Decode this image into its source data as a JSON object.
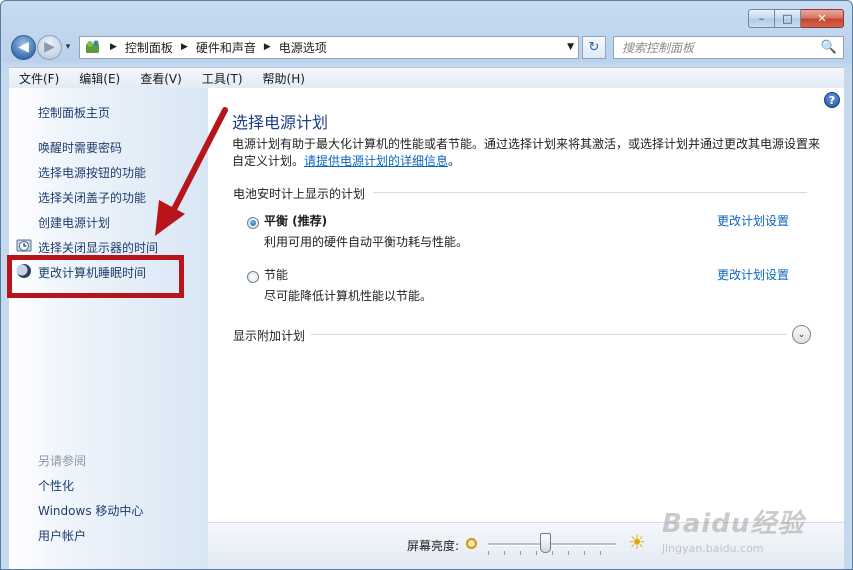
{
  "window": {
    "controls": {
      "minimize": "–",
      "maximize": "□",
      "close": "✕"
    }
  },
  "nav": {
    "back_glyph": "◀",
    "forward_glyph": "▶",
    "history_glyph": "▾",
    "breadcrumb": [
      "控制面板",
      "硬件和声音",
      "电源选项"
    ],
    "search_placeholder": "搜索控制面板",
    "refresh_glyph": "↻",
    "dropdown_glyph": "▼",
    "search_glyph": "🔍"
  },
  "menu": [
    "文件(F)",
    "编辑(E)",
    "查看(V)",
    "工具(T)",
    "帮助(H)"
  ],
  "sidebar": {
    "home": "控制面板主页",
    "items": [
      "唤醒时需要密码",
      "选择电源按钮的功能",
      "选择关闭盖子的功能",
      "创建电源计划",
      "选择关闭显示器的时间",
      "更改计算机睡眠时间"
    ],
    "see_also_heading": "另请参阅",
    "see_also": [
      "个性化",
      "Windows 移动中心",
      "用户帐户"
    ]
  },
  "main": {
    "help_glyph": "?",
    "title": "选择电源计划",
    "description": "电源计划有助于最大化计算机的性能或者节能。通过选择计划来将其激活，或选择计划并通过更改其电源设置来自定义计划。",
    "description_link": "请提供电源计划的详细信息",
    "description_end": "。",
    "group_title": "电池安时计上显示的计划",
    "plans": [
      {
        "name": "平衡 (推荐)",
        "desc": "利用可用的硬件自动平衡功耗与性能。",
        "selected": true,
        "link": "更改计划设置"
      },
      {
        "name": "节能",
        "desc": "尽可能降低计算机性能以节能。",
        "selected": false,
        "link": "更改计划设置"
      }
    ],
    "additional_plans": "显示附加计划",
    "expand_glyph": "⌄"
  },
  "status": {
    "brightness_label": "屏幕亮度:",
    "brightness_level": 0.45,
    "sun_glyph": "☀"
  },
  "watermark": {
    "line1": "Baidu经验",
    "line2": "jingyan.baidu.com"
  },
  "colors": {
    "highlight_box": "#b8141b",
    "link": "#0b66c2",
    "title": "#1c3f8c"
  }
}
